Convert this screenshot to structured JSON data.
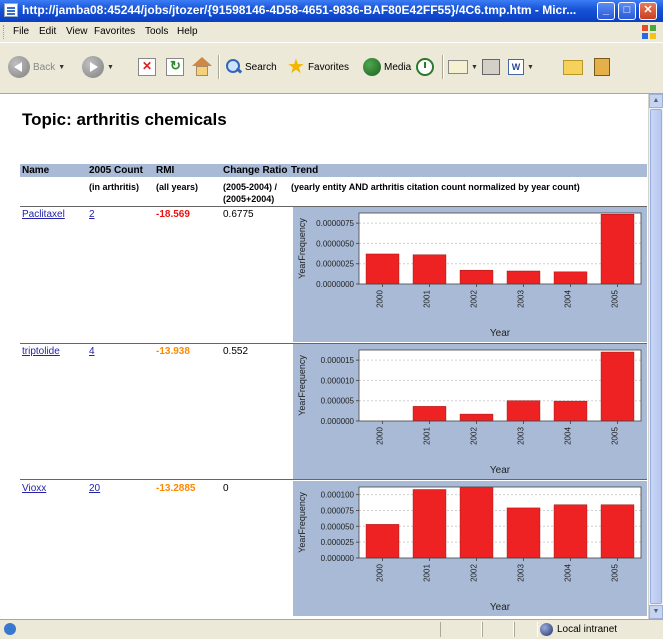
{
  "window": {
    "title": "http://jamba08:45244/jobs/jtozer/{91598146-4D58-4651-9836-BAF80E42FF55}/4C6.tmp.htm - Micr..."
  },
  "menu": [
    "File",
    "Edit",
    "View",
    "Favorites",
    "Tools",
    "Help"
  ],
  "toolbar": {
    "back": "Back",
    "search": "Search",
    "favorites": "Favorites",
    "media": "Media"
  },
  "page": {
    "title": "Topic: arthritis chemicals",
    "headers": {
      "name": "Name",
      "count": "2005 Count",
      "rmi": "RMI",
      "change": "Change Ratio",
      "trend": "Trend"
    },
    "subheaders": {
      "count": "(in arthritis)",
      "rmi": "(all years)",
      "change1": "(2005-2004) /",
      "change2": "(2005+2004)",
      "trend": "(yearly entity AND arthritis citation count normalized by year count)"
    }
  },
  "colors": {
    "rmi_red": "#ee1111",
    "rmi_orange": "#ff8800",
    "bar": "#ee2222",
    "panel": "#a8bad6"
  },
  "rows": [
    {
      "name": "Paclitaxel",
      "count": "2",
      "rmi": "-18.569",
      "rmi_color": "#ee1111",
      "change": "0.6775",
      "chart_data": {
        "type": "bar",
        "categories": [
          "2000",
          "2001",
          "2002",
          "2003",
          "2004",
          "2005"
        ],
        "values": [
          3.7e-06,
          3.6e-06,
          1.7e-06,
          1.6e-06,
          1.5e-06,
          8.6e-06
        ],
        "ylim": [
          0,
          8.75e-06
        ],
        "yticks": [
          "0.0000000",
          "0.0000025",
          "0.0000050",
          "0.0000075"
        ],
        "ytick_values": [
          0,
          2.5e-06,
          5e-06,
          7.5e-06
        ],
        "xlabel": "Year",
        "ylabel": "YearFrequency"
      }
    },
    {
      "name": "triptolide",
      "count": "4",
      "rmi": "-13.938",
      "rmi_color": "#ff8800",
      "change": "0.552",
      "chart_data": {
        "type": "bar",
        "categories": [
          "2000",
          "2001",
          "2002",
          "2003",
          "2004",
          "2005"
        ],
        "values": [
          0,
          3.6e-06,
          1.7e-06,
          5e-06,
          4.9e-06,
          1.7e-05
        ],
        "ylim": [
          0,
          1.75e-05
        ],
        "yticks": [
          "0.000000",
          "0.000005",
          "0.000010",
          "0.000015"
        ],
        "ytick_values": [
          0,
          5e-06,
          1e-05,
          1.5e-05
        ],
        "xlabel": "Year",
        "ylabel": "YearFrequency"
      }
    },
    {
      "name": "Vioxx",
      "count": "20",
      "rmi": "-13.2885",
      "rmi_color": "#ff8800",
      "change": "0",
      "chart_data": {
        "type": "bar",
        "categories": [
          "2000",
          "2001",
          "2002",
          "2003",
          "2004",
          "2005"
        ],
        "values": [
          5.3e-05,
          0.000108,
          0.000111,
          7.9e-05,
          8.4e-05,
          8.4e-05
        ],
        "ylim": [
          0,
          0.000112
        ],
        "yticks": [
          "0.000000",
          "0.000025",
          "0.000050",
          "0.000075",
          "0.000100"
        ],
        "ytick_values": [
          0,
          2.5e-05,
          5e-05,
          7.5e-05,
          0.0001
        ],
        "xlabel": "Year",
        "ylabel": "YearFrequency"
      }
    }
  ],
  "status": {
    "zone": "Local intranet"
  }
}
